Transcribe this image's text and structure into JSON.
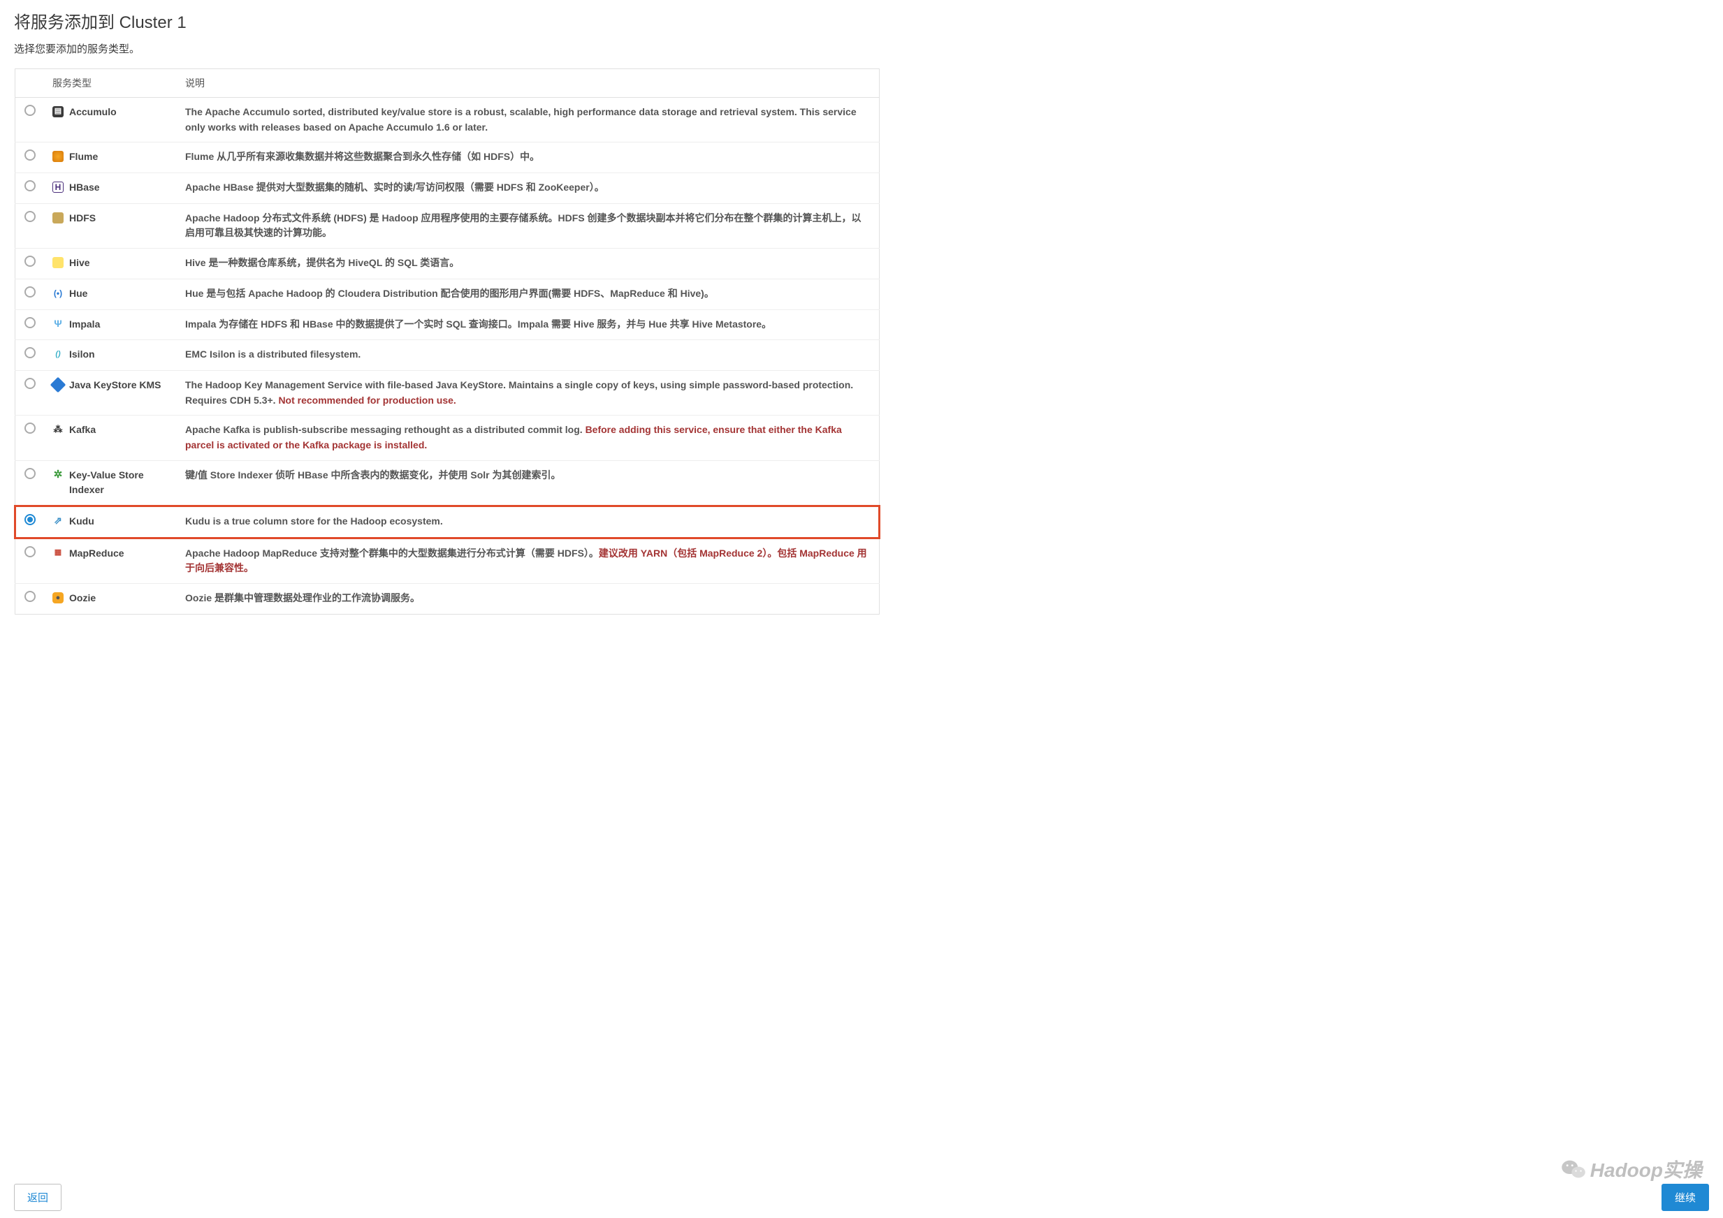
{
  "page": {
    "title": "将服务添加到 Cluster 1",
    "subtitle": "选择您要添加的服务类型。"
  },
  "table": {
    "headers": {
      "type": "服务类型",
      "desc": "说明"
    }
  },
  "services": [
    {
      "id": "accumulo",
      "name": "Accumulo",
      "icon_cls": "ic-accumulo",
      "icon_glyph": "▤",
      "selected": false,
      "highlighted": false,
      "desc": "The Apache Accumulo sorted, distributed key/value store is a robust, scalable, high performance data storage and retrieval system. This service only works with releases based on Apache Accumulo 1.6 or later.",
      "warn": ""
    },
    {
      "id": "flume",
      "name": "Flume",
      "icon_cls": "ic-flume",
      "icon_glyph": "",
      "selected": false,
      "highlighted": false,
      "desc": "Flume 从几乎所有来源收集数据并将这些数据聚合到永久性存储（如 HDFS）中。",
      "warn": ""
    },
    {
      "id": "hbase",
      "name": "HBase",
      "icon_cls": "ic-hbase",
      "icon_glyph": "H",
      "selected": false,
      "highlighted": false,
      "desc": "Apache HBase 提供对大型数据集的随机、实时的读/写访问权限（需要 HDFS 和 ZooKeeper）。",
      "warn": ""
    },
    {
      "id": "hdfs",
      "name": "HDFS",
      "icon_cls": "ic-hdfs",
      "icon_glyph": "",
      "selected": false,
      "highlighted": false,
      "desc": "Apache Hadoop 分布式文件系统 (HDFS) 是 Hadoop 应用程序使用的主要存储系统。HDFS 创建多个数据块副本并将它们分布在整个群集的计算主机上，以启用可靠且极其快速的计算功能。",
      "warn": ""
    },
    {
      "id": "hive",
      "name": "Hive",
      "icon_cls": "ic-hive",
      "icon_glyph": "",
      "selected": false,
      "highlighted": false,
      "desc": "Hive 是一种数据仓库系统，提供名为 HiveQL 的 SQL 类语言。",
      "warn": ""
    },
    {
      "id": "hue",
      "name": "Hue",
      "icon_cls": "ic-hue",
      "icon_glyph": "(•)",
      "selected": false,
      "highlighted": false,
      "desc": "Hue 是与包括 Apache Hadoop 的 Cloudera Distribution 配合使用的图形用户界面(需要 HDFS、MapReduce 和 Hive)。",
      "warn": ""
    },
    {
      "id": "impala",
      "name": "Impala",
      "icon_cls": "ic-impala",
      "icon_glyph": "Ψ",
      "selected": false,
      "highlighted": false,
      "desc": "Impala 为存储在 HDFS 和 HBase 中的数据提供了一个实时 SQL 查询接口。Impala 需要 Hive 服务，并与 Hue 共享 Hive Metastore。",
      "warn": ""
    },
    {
      "id": "isilon",
      "name": "Isilon",
      "icon_cls": "ic-isilon",
      "icon_glyph": "()",
      "selected": false,
      "highlighted": false,
      "desc": "EMC Isilon is a distributed filesystem.",
      "warn": ""
    },
    {
      "id": "kms",
      "name": "Java KeyStore KMS",
      "icon_cls": "ic-kms",
      "icon_glyph": "",
      "selected": false,
      "highlighted": false,
      "desc": "The Hadoop Key Management Service with file-based Java KeyStore. Maintains a single copy of keys, using simple password-based protection. Requires CDH 5.3+. ",
      "warn": "Not recommended for production use."
    },
    {
      "id": "kafka",
      "name": "Kafka",
      "icon_cls": "ic-kafka",
      "icon_glyph": "⁂",
      "selected": false,
      "highlighted": false,
      "desc": "Apache Kafka is publish-subscribe messaging rethought as a distributed commit log. ",
      "warn": "Before adding this service, ensure that either the Kafka parcel is activated or the Kafka package is installed."
    },
    {
      "id": "kvsi",
      "name": "Key-Value Store Indexer",
      "icon_cls": "ic-kvsi",
      "icon_glyph": "✲",
      "selected": false,
      "highlighted": false,
      "desc": "键/值 Store Indexer 侦听 HBase 中所含表内的数据变化，并使用 Solr 为其创建索引。",
      "warn": ""
    },
    {
      "id": "kudu",
      "name": "Kudu",
      "icon_cls": "ic-kudu",
      "icon_glyph": "⇗",
      "selected": true,
      "highlighted": true,
      "desc": "Kudu is a true column store for the Hadoop ecosystem.",
      "warn": ""
    },
    {
      "id": "mapreduce",
      "name": "MapReduce",
      "icon_cls": "ic-mapreduce",
      "icon_glyph": "▦",
      "selected": false,
      "highlighted": false,
      "desc": "Apache Hadoop MapReduce 支持对整个群集中的大型数据集进行分布式计算（需要 HDFS）。",
      "warn": "建议改用 YARN（包括 MapReduce 2）。包括 MapReduce 用于向后兼容性。"
    },
    {
      "id": "oozie",
      "name": "Oozie",
      "icon_cls": "ic-oozie",
      "icon_glyph": "●",
      "selected": false,
      "highlighted": false,
      "desc": "Oozie 是群集中管理数据处理作业的工作流协调服务。",
      "warn": ""
    }
  ],
  "footer": {
    "back": "返回",
    "continue": "继续"
  },
  "watermark": "Hadoop实操"
}
